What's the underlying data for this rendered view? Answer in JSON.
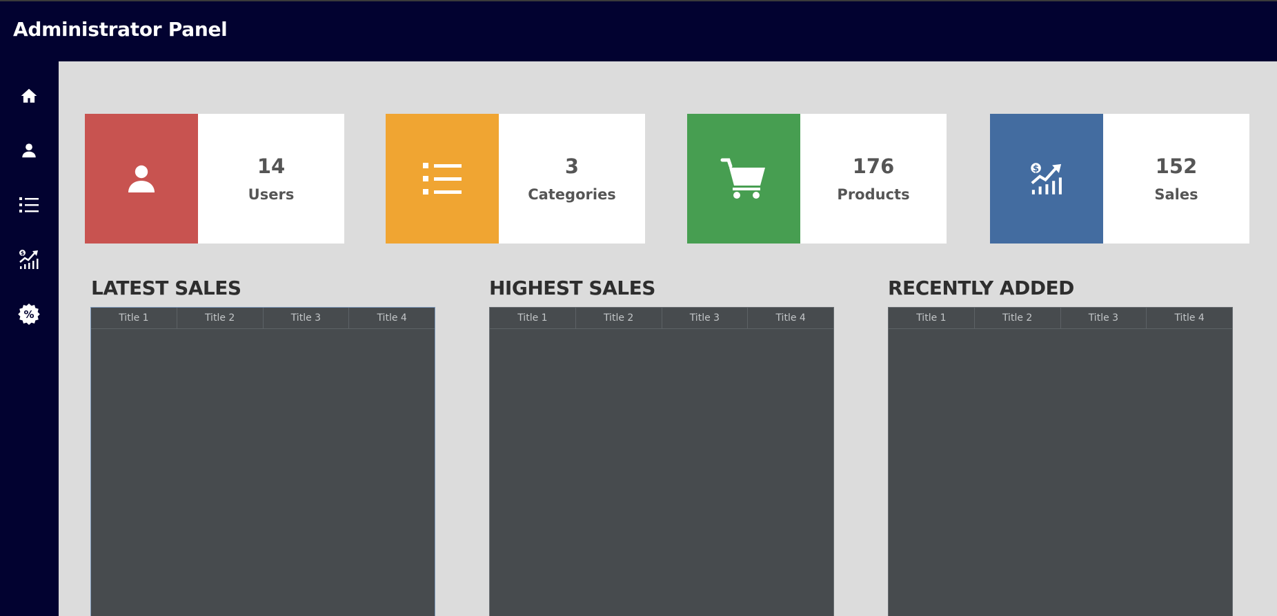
{
  "app": {
    "title": "Administrator Panel"
  },
  "sidebar": {
    "items": [
      {
        "icon": "home-icon"
      },
      {
        "icon": "user-icon"
      },
      {
        "icon": "list-icon"
      },
      {
        "icon": "sales-chart-icon"
      },
      {
        "icon": "discount-badge-icon"
      }
    ]
  },
  "stats": [
    {
      "value": "14",
      "label": "Users",
      "color": "#c85350",
      "icon": "user-icon"
    },
    {
      "value": "3",
      "label": "Categories",
      "color": "#f0a532",
      "icon": "list-icon"
    },
    {
      "value": "176",
      "label": "Products",
      "color": "#479e51",
      "icon": "cart-icon"
    },
    {
      "value": "152",
      "label": "Sales",
      "color": "#436ca0",
      "icon": "sales-chart-icon"
    }
  ],
  "sections": [
    {
      "title": "LATEST SALES",
      "columns": [
        "Title 1",
        "Title 2",
        "Title 3",
        "Title 4"
      ]
    },
    {
      "title": "HIGHEST SALES",
      "columns": [
        "Title 1",
        "Title 2",
        "Title 3",
        "Title 4"
      ]
    },
    {
      "title": "RECENTLY ADDED",
      "columns": [
        "Title 1",
        "Title 2",
        "Title 3",
        "Title 4"
      ]
    }
  ]
}
